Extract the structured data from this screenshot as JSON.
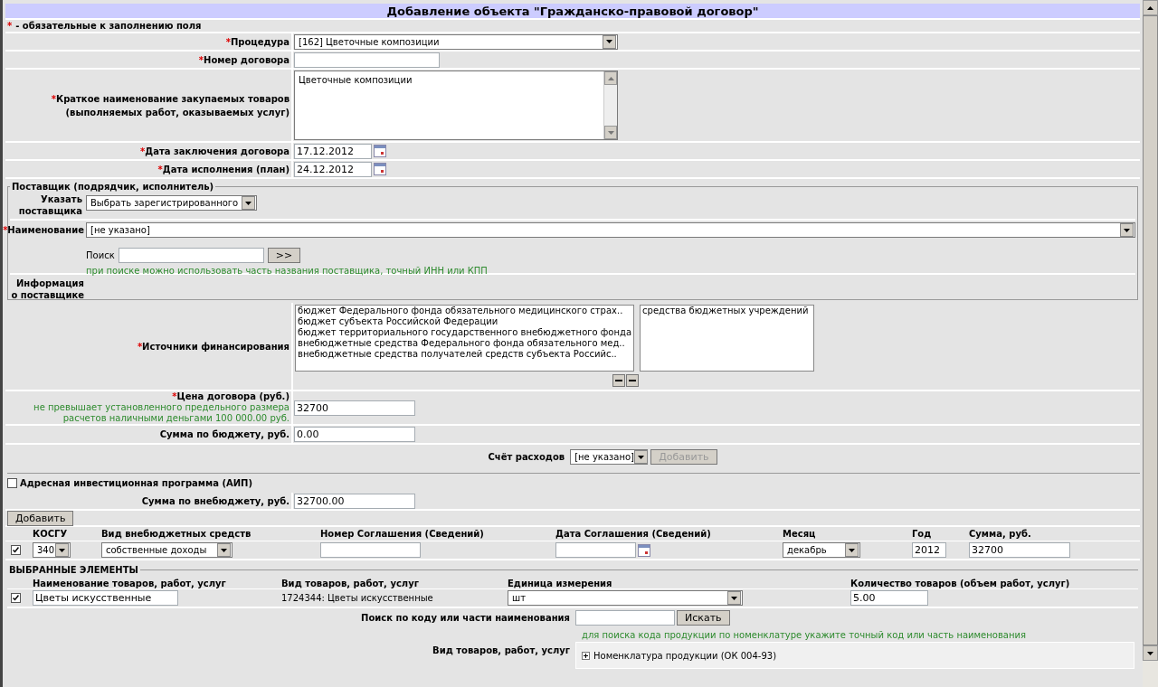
{
  "title": "Добавление объекта \"Гражданско-правовой договор\"",
  "required_note": {
    "mark": "*",
    "text": "- обязательные к заполнению поля"
  },
  "fields": [
    {
      "kind": "select",
      "label": "Процедура",
      "required": true,
      "value": "[162] Цветочные композиции"
    },
    {
      "kind": "input",
      "label": "Номер договора",
      "required": true
    },
    {
      "kind": "textarea",
      "label": "Краткое наименование закупаемых товаров (выполняемых работ, оказываемых услуг)",
      "required": true,
      "value": "Цветочные композиции"
    },
    {
      "kind": "date",
      "label": "Дата заключения договора",
      "required": true,
      "value": "17.12.2012"
    },
    {
      "kind": "date",
      "label": "Дата исполнения (план)",
      "required": true,
      "value": "24.12.2012"
    }
  ],
  "supplier": {
    "legend": "Поставщик (подрядчик, исполнитель)",
    "specify_label": "Указать поставщика",
    "specify_value": "Выбрать зарегистрированного",
    "name_label": "Наименование",
    "name_required": true,
    "name_value": "[не указано]",
    "search_label": "Поиск",
    "search_button": ">>",
    "hint": "при поиске можно использовать часть названия поставщика, точный ИНН или КПП",
    "info_label": "Информация о поставщике"
  },
  "financing": {
    "label": "Источники финансирования",
    "required": true,
    "available": [
      "бюджет Федерального фонда обязательного медицинского страх..",
      "бюджет субъекта Российской Федерации",
      "бюджет территориального государственного внебюджетного фонда",
      "внебюджетные средства Федерального фонда обязательного мед..",
      "внебюджетные средства получателей средств субъекта Российс.."
    ],
    "selected": [
      "средства бюджетных учреждений"
    ]
  },
  "price": {
    "label": "Цена договора (руб.)",
    "required": true,
    "note": "не превышает установленного предельного размера расчетов наличными деньгами 100 000.00 руб.",
    "value": "32700"
  },
  "budget": {
    "label": "Сумма по бюджету, руб.",
    "value": "0.00"
  },
  "expense": {
    "label": "Счёт расходов",
    "value": "[не указано]",
    "button": "Добавить",
    "button_disabled": true
  },
  "aip": {
    "label": "Адресная инвестиционная программа (АИП)",
    "checked": false
  },
  "extra_sum": {
    "label": "Сумма по внебюджету, руб.",
    "value": "32700.00"
  },
  "add_button": "Добавить",
  "extra_table": {
    "columns": [
      "КОСГУ",
      "Вид внебюджетных средств",
      "Номер Соглашения (Сведений)",
      "Дата Соглашения (Сведений)",
      "Месяц",
      "Год",
      "Сумма, руб."
    ],
    "rows": [
      {
        "checked": true,
        "kosgu": "340",
        "source": "собственные доходы",
        "month": "декабрь",
        "year": "2012",
        "sum": "32700"
      }
    ]
  },
  "selected_items": {
    "legend": "ВЫБРАННЫЕ ЭЛЕМЕНТЫ",
    "columns": [
      "Наименование товаров, работ, услуг",
      "Вид товаров, работ, услуг",
      "Единица измерения",
      "Количество товаров (объем работ, услуг)"
    ],
    "rows": [
      {
        "checked": true,
        "name": "Цветы искусственные",
        "kind_text": "1724344: Цветы искусственные",
        "unit": "шт",
        "quantity": "5.00"
      }
    ]
  },
  "product_search": {
    "label": "Поиск по коду или части наименования",
    "button": "Искать",
    "hint": "для поиска кода продукции по номенклатуре укажите точный код или часть наименования",
    "kind_label": "Вид товаров, работ, услуг",
    "tree": [
      {
        "label": "Номенклатура продукции (ОК 004-93)",
        "expanded": false
      }
    ]
  }
}
